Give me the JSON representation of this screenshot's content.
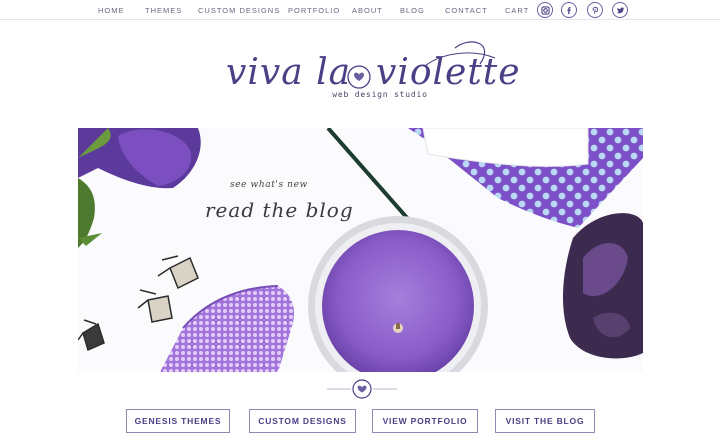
{
  "nav": {
    "items": [
      "HOME",
      "THEMES",
      "CUSTOM DESIGNS",
      "PORTFOLIO",
      "ABOUT",
      "BLOG",
      "CONTACT",
      "CART"
    ],
    "social_icons": [
      "instagram-icon",
      "facebook-icon",
      "pinterest-icon",
      "twitter-icon"
    ]
  },
  "logo": {
    "text_left": "viva la",
    "text_right": "violette",
    "tagline": "web design studio"
  },
  "hero": {
    "kicker": "see what's new",
    "title": "read the blog"
  },
  "buttons": [
    "GENESIS THEMES",
    "CUSTOM DESIGNS",
    "VIEW PORTFOLIO",
    "VISIT THE BLOG"
  ],
  "colors": {
    "accent": "#4b3f86",
    "purple": "#8a5cc9",
    "border": "#8f8ab3"
  }
}
